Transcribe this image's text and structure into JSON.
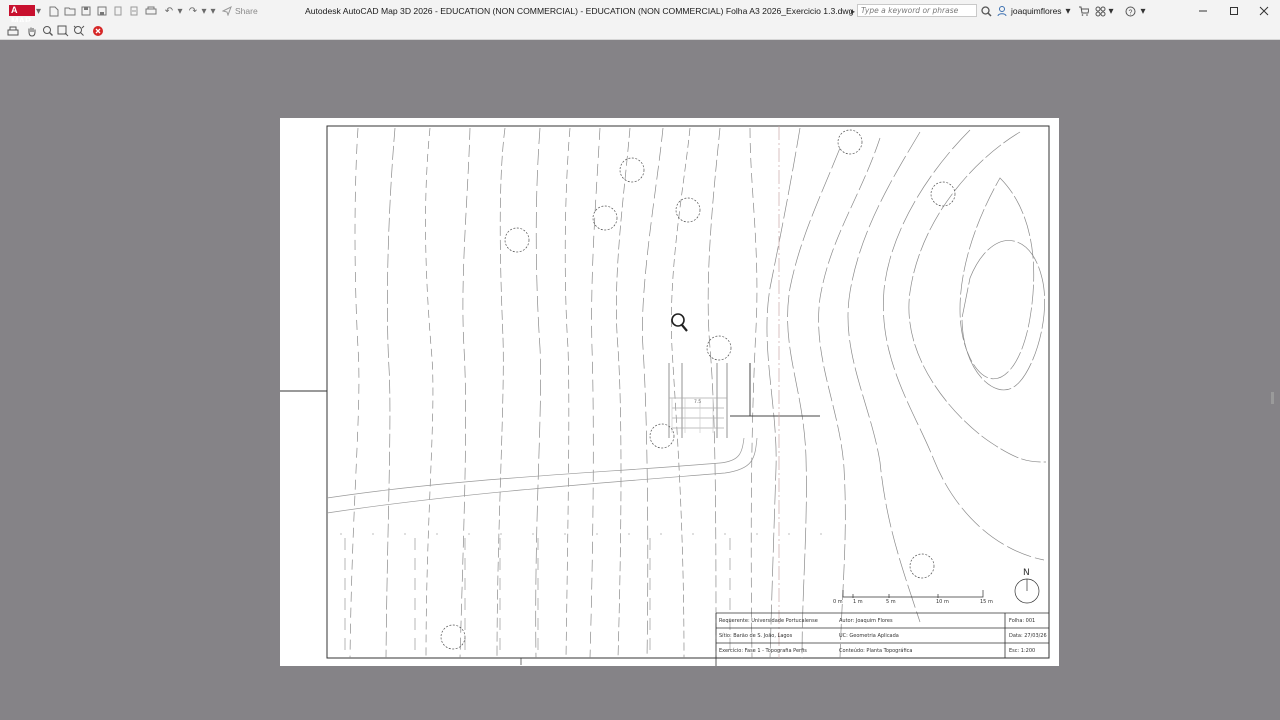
{
  "window": {
    "title": "Autodesk AutoCAD Map 3D 2026 - EDUCATION (NON COMMERCIAL) - EDUCATION (NON COMMERCIAL)    Folha A3 2026_Exercicio 1.3.dwg",
    "logo_text": "A MAP",
    "share_label": "Share",
    "search_placeholder": "Type a keyword or phrase",
    "username": "joaquimflores"
  },
  "icons": {
    "new": "new-file-icon",
    "open": "open-file-icon",
    "save": "save-icon",
    "save_as": "save-as-icon",
    "plot": "plot-icon",
    "undo": "undo-icon",
    "redo": "redo-icon",
    "share": "share-icon",
    "search": "search-icon",
    "user": "user-icon",
    "cart": "cart-icon",
    "apps": "apps-icon",
    "help": "help-icon",
    "minimize": "minimize-icon",
    "maximize": "maximize-icon",
    "close": "close-icon",
    "print_preview": "print-icon",
    "pan": "pan-icon",
    "zoom": "zoom-icon",
    "zoom_window": "zoom-window-icon",
    "zoom_extents": "zoom-extents-icon",
    "close_preview": "close-preview-icon"
  },
  "colors": {
    "background": "#858387",
    "paper": "#ffffff",
    "brand_red": "#c8102e",
    "axis_line": "#c9a8a8"
  },
  "drawing": {
    "building_label": "7.5",
    "scale_bar_labels": [
      "0 m",
      "1 m",
      "5 m",
      "10 m",
      "15 m"
    ],
    "north_label": "N",
    "title_block": {
      "rows": [
        [
          "Requerente: Universidade Portucalense",
          "Autor: Joaquim Flores",
          "Folha: 001"
        ],
        [
          "Sítio: Barão de S. João, Lagos",
          "UC: Geometria Aplicada",
          "Data: 27/03/26"
        ],
        [
          "Exercício: Fase 1 - Topografia Perfis",
          "Conteúdo: Planta Topográfica",
          "Esc: 1:200"
        ]
      ]
    }
  }
}
